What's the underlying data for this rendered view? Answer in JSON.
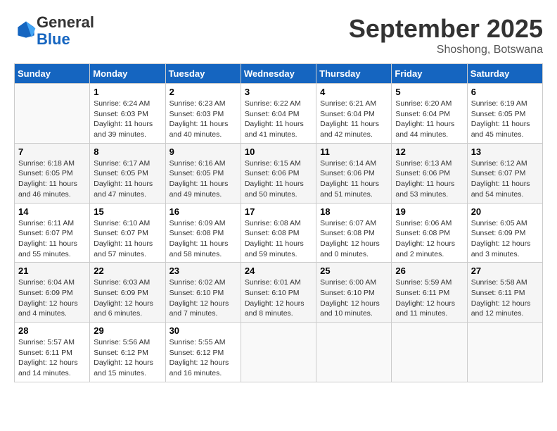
{
  "logo": {
    "general": "General",
    "blue": "Blue"
  },
  "title": "September 2025",
  "location": "Shoshong, Botswana",
  "weekdays": [
    "Sunday",
    "Monday",
    "Tuesday",
    "Wednesday",
    "Thursday",
    "Friday",
    "Saturday"
  ],
  "weeks": [
    [
      {
        "day": "",
        "info": ""
      },
      {
        "day": "1",
        "info": "Sunrise: 6:24 AM\nSunset: 6:03 PM\nDaylight: 11 hours\nand 39 minutes."
      },
      {
        "day": "2",
        "info": "Sunrise: 6:23 AM\nSunset: 6:03 PM\nDaylight: 11 hours\nand 40 minutes."
      },
      {
        "day": "3",
        "info": "Sunrise: 6:22 AM\nSunset: 6:04 PM\nDaylight: 11 hours\nand 41 minutes."
      },
      {
        "day": "4",
        "info": "Sunrise: 6:21 AM\nSunset: 6:04 PM\nDaylight: 11 hours\nand 42 minutes."
      },
      {
        "day": "5",
        "info": "Sunrise: 6:20 AM\nSunset: 6:04 PM\nDaylight: 11 hours\nand 44 minutes."
      },
      {
        "day": "6",
        "info": "Sunrise: 6:19 AM\nSunset: 6:05 PM\nDaylight: 11 hours\nand 45 minutes."
      }
    ],
    [
      {
        "day": "7",
        "info": "Sunrise: 6:18 AM\nSunset: 6:05 PM\nDaylight: 11 hours\nand 46 minutes."
      },
      {
        "day": "8",
        "info": "Sunrise: 6:17 AM\nSunset: 6:05 PM\nDaylight: 11 hours\nand 47 minutes."
      },
      {
        "day": "9",
        "info": "Sunrise: 6:16 AM\nSunset: 6:05 PM\nDaylight: 11 hours\nand 49 minutes."
      },
      {
        "day": "10",
        "info": "Sunrise: 6:15 AM\nSunset: 6:06 PM\nDaylight: 11 hours\nand 50 minutes."
      },
      {
        "day": "11",
        "info": "Sunrise: 6:14 AM\nSunset: 6:06 PM\nDaylight: 11 hours\nand 51 minutes."
      },
      {
        "day": "12",
        "info": "Sunrise: 6:13 AM\nSunset: 6:06 PM\nDaylight: 11 hours\nand 53 minutes."
      },
      {
        "day": "13",
        "info": "Sunrise: 6:12 AM\nSunset: 6:07 PM\nDaylight: 11 hours\nand 54 minutes."
      }
    ],
    [
      {
        "day": "14",
        "info": "Sunrise: 6:11 AM\nSunset: 6:07 PM\nDaylight: 11 hours\nand 55 minutes."
      },
      {
        "day": "15",
        "info": "Sunrise: 6:10 AM\nSunset: 6:07 PM\nDaylight: 11 hours\nand 57 minutes."
      },
      {
        "day": "16",
        "info": "Sunrise: 6:09 AM\nSunset: 6:08 PM\nDaylight: 11 hours\nand 58 minutes."
      },
      {
        "day": "17",
        "info": "Sunrise: 6:08 AM\nSunset: 6:08 PM\nDaylight: 11 hours\nand 59 minutes."
      },
      {
        "day": "18",
        "info": "Sunrise: 6:07 AM\nSunset: 6:08 PM\nDaylight: 12 hours\nand 0 minutes."
      },
      {
        "day": "19",
        "info": "Sunrise: 6:06 AM\nSunset: 6:08 PM\nDaylight: 12 hours\nand 2 minutes."
      },
      {
        "day": "20",
        "info": "Sunrise: 6:05 AM\nSunset: 6:09 PM\nDaylight: 12 hours\nand 3 minutes."
      }
    ],
    [
      {
        "day": "21",
        "info": "Sunrise: 6:04 AM\nSunset: 6:09 PM\nDaylight: 12 hours\nand 4 minutes."
      },
      {
        "day": "22",
        "info": "Sunrise: 6:03 AM\nSunset: 6:09 PM\nDaylight: 12 hours\nand 6 minutes."
      },
      {
        "day": "23",
        "info": "Sunrise: 6:02 AM\nSunset: 6:10 PM\nDaylight: 12 hours\nand 7 minutes."
      },
      {
        "day": "24",
        "info": "Sunrise: 6:01 AM\nSunset: 6:10 PM\nDaylight: 12 hours\nand 8 minutes."
      },
      {
        "day": "25",
        "info": "Sunrise: 6:00 AM\nSunset: 6:10 PM\nDaylight: 12 hours\nand 10 minutes."
      },
      {
        "day": "26",
        "info": "Sunrise: 5:59 AM\nSunset: 6:11 PM\nDaylight: 12 hours\nand 11 minutes."
      },
      {
        "day": "27",
        "info": "Sunrise: 5:58 AM\nSunset: 6:11 PM\nDaylight: 12 hours\nand 12 minutes."
      }
    ],
    [
      {
        "day": "28",
        "info": "Sunrise: 5:57 AM\nSunset: 6:11 PM\nDaylight: 12 hours\nand 14 minutes."
      },
      {
        "day": "29",
        "info": "Sunrise: 5:56 AM\nSunset: 6:12 PM\nDaylight: 12 hours\nand 15 minutes."
      },
      {
        "day": "30",
        "info": "Sunrise: 5:55 AM\nSunset: 6:12 PM\nDaylight: 12 hours\nand 16 minutes."
      },
      {
        "day": "",
        "info": ""
      },
      {
        "day": "",
        "info": ""
      },
      {
        "day": "",
        "info": ""
      },
      {
        "day": "",
        "info": ""
      }
    ]
  ]
}
